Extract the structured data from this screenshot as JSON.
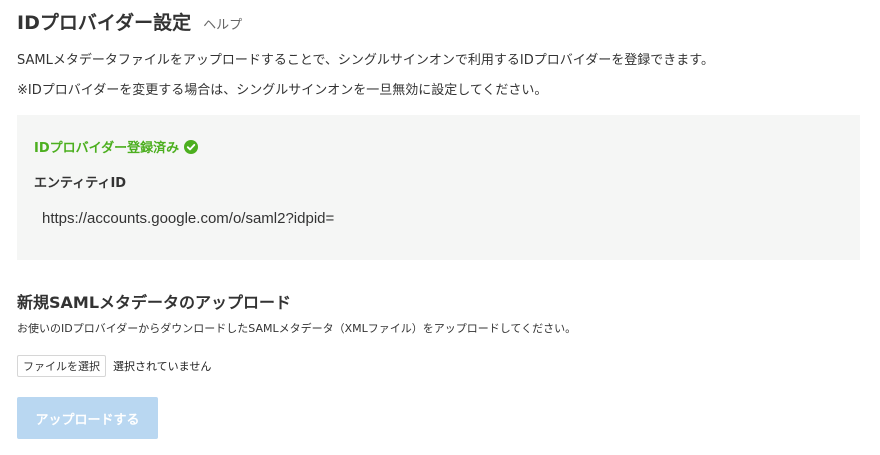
{
  "header": {
    "title": "IDプロバイダー設定",
    "help_label": "ヘルプ"
  },
  "description": {
    "line1": "SAMLメタデータファイルをアップロードすることで、シングルサインオンで利用するIDプロバイダーを登録できます。",
    "line2": "※IDプロバイダーを変更する場合は、シングルサインオンを一旦無効に設定してください。"
  },
  "status": {
    "registered_label": "IDプロバイダー登録済み",
    "registered_icon": "check-circle-icon",
    "registered_color": "#4caf1f",
    "entity_id_label": "エンティティID",
    "entity_id_value": "https://accounts.google.com/o/saml2?idpid="
  },
  "upload": {
    "heading": "新規SAMLメタデータのアップロード",
    "description": "お使いのIDプロバイダーからダウンロードしたSAMLメタデータ（XMLファイル）をアップロードしてください。",
    "choose_file_label": "ファイルを選択",
    "file_status": "選択されていません",
    "submit_label": "アップロードする",
    "submit_disabled": true,
    "submit_color": "#b9d7f1"
  }
}
